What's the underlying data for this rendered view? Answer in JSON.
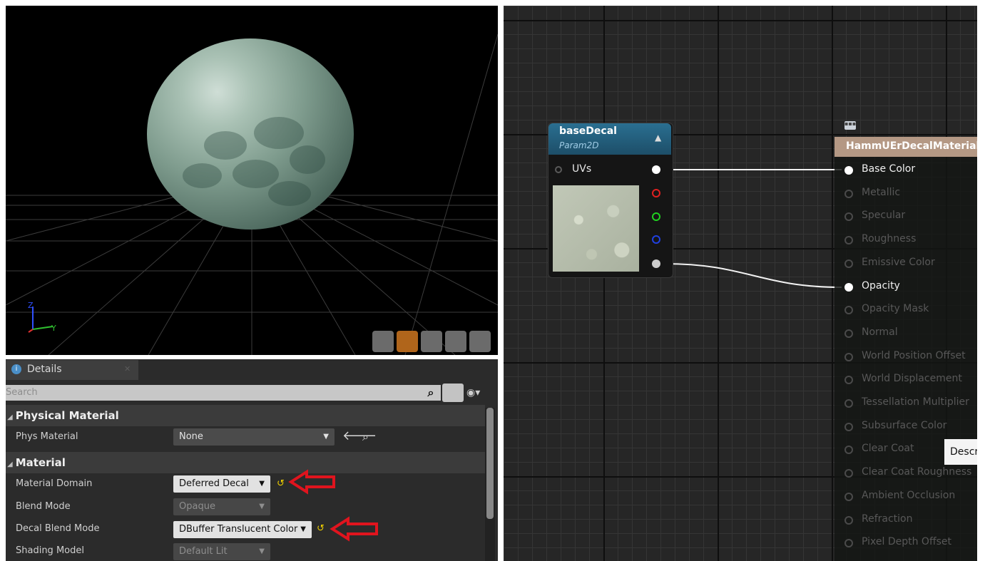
{
  "viewport": {
    "buttons": [
      "cylinder-icon",
      "sphere-icon",
      "plane-icon",
      "cube-icon",
      "teapot-icon"
    ],
    "active_button": "sphere-icon"
  },
  "details": {
    "tab_label": "Details",
    "search_placeholder": "Search",
    "sections": [
      {
        "title": "Physical Material",
        "properties": [
          {
            "label": "Phys Material",
            "value": "None"
          }
        ]
      },
      {
        "title": "Material",
        "properties": [
          {
            "label": "Material Domain",
            "value": "Deferred Decal"
          },
          {
            "label": "Blend Mode",
            "value": "Opaque"
          },
          {
            "label": "Decal Blend Mode",
            "value": "DBuffer Translucent Color"
          },
          {
            "label": "Shading Model",
            "value": "Default Lit"
          }
        ]
      }
    ],
    "annotation_color": "#e0141e"
  },
  "graph": {
    "texture_node": {
      "title": "baseDecal",
      "subtitle": "Param2D",
      "input_label": "UVs",
      "output_pin_colors": [
        "#ffffff",
        "#e02020",
        "#20d020",
        "#2040e0",
        "#cccccc"
      ]
    },
    "material_node": {
      "title": "HammUErDecalMaterial",
      "inputs": [
        {
          "label": "Base Color",
          "connected": true
        },
        {
          "label": "Metallic",
          "connected": false
        },
        {
          "label": "Specular",
          "connected": false
        },
        {
          "label": "Roughness",
          "connected": false
        },
        {
          "label": "Emissive Color",
          "connected": false
        },
        {
          "label": "Opacity",
          "connected": true
        },
        {
          "label": "Opacity Mask",
          "connected": false
        },
        {
          "label": "Normal",
          "connected": false
        },
        {
          "label": "World Position Offset",
          "connected": false
        },
        {
          "label": "World Displacement",
          "connected": false
        },
        {
          "label": "Tessellation Multiplier",
          "connected": false
        },
        {
          "label": "Subsurface Color",
          "connected": false
        },
        {
          "label": "Clear Coat",
          "connected": false
        },
        {
          "label": "Clear Coat Roughness",
          "connected": false
        },
        {
          "label": "Ambient Occlusion",
          "connected": false
        },
        {
          "label": "Refraction",
          "connected": false
        },
        {
          "label": "Pixel Depth Offset",
          "connected": false
        }
      ]
    },
    "tooltip": "Description"
  }
}
